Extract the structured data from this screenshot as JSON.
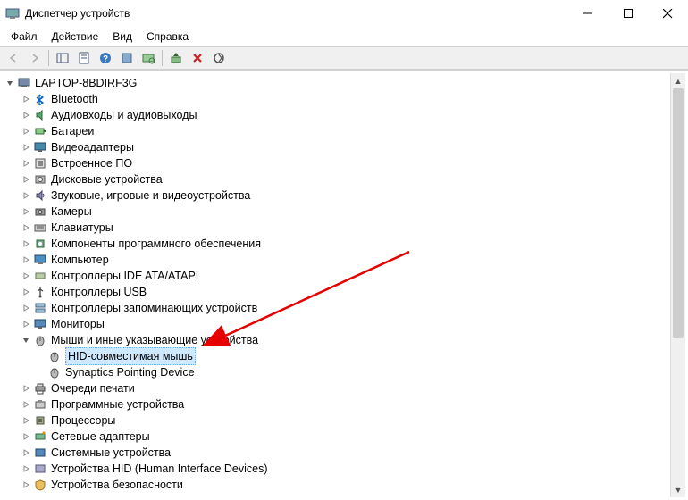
{
  "window": {
    "title": "Диспетчер устройств"
  },
  "menu": {
    "file": "Файл",
    "action": "Действие",
    "view": "Вид",
    "help": "Справка"
  },
  "tree": {
    "root": "LAPTOP-8BDIRF3G",
    "items": [
      {
        "label": "Bluetooth",
        "icon": "bluetooth"
      },
      {
        "label": "Аудиовходы и аудиовыходы",
        "icon": "audio"
      },
      {
        "label": "Батареи",
        "icon": "battery"
      },
      {
        "label": "Видеоадаптеры",
        "icon": "display"
      },
      {
        "label": "Встроенное ПО",
        "icon": "firmware"
      },
      {
        "label": "Дисковые устройства",
        "icon": "disk"
      },
      {
        "label": "Звуковые, игровые и видеоустройства",
        "icon": "sound"
      },
      {
        "label": "Камеры",
        "icon": "camera"
      },
      {
        "label": "Клавиатуры",
        "icon": "keyboard"
      },
      {
        "label": "Компоненты программного обеспечения",
        "icon": "component"
      },
      {
        "label": "Компьютер",
        "icon": "computer"
      },
      {
        "label": "Контроллеры IDE ATA/ATAPI",
        "icon": "ide"
      },
      {
        "label": "Контроллеры USB",
        "icon": "usb"
      },
      {
        "label": "Контроллеры запоминающих устройств",
        "icon": "storage"
      },
      {
        "label": "Мониторы",
        "icon": "monitor"
      }
    ],
    "mouse_cat": "Мыши и иные указывающие устройства",
    "mouse_children": [
      {
        "label": "HID-совместимая мышь",
        "selected": true
      },
      {
        "label": "Synaptics Pointing Device",
        "selected": false
      }
    ],
    "after": [
      {
        "label": "Очереди печати",
        "icon": "print"
      },
      {
        "label": "Программные устройства",
        "icon": "softdev"
      },
      {
        "label": "Процессоры",
        "icon": "cpu"
      },
      {
        "label": "Сетевые адаптеры",
        "icon": "network"
      },
      {
        "label": "Системные устройства",
        "icon": "system"
      },
      {
        "label": "Устройства HID (Human Interface Devices)",
        "icon": "hid"
      },
      {
        "label": "Устройства безопасности",
        "icon": "security"
      }
    ]
  }
}
